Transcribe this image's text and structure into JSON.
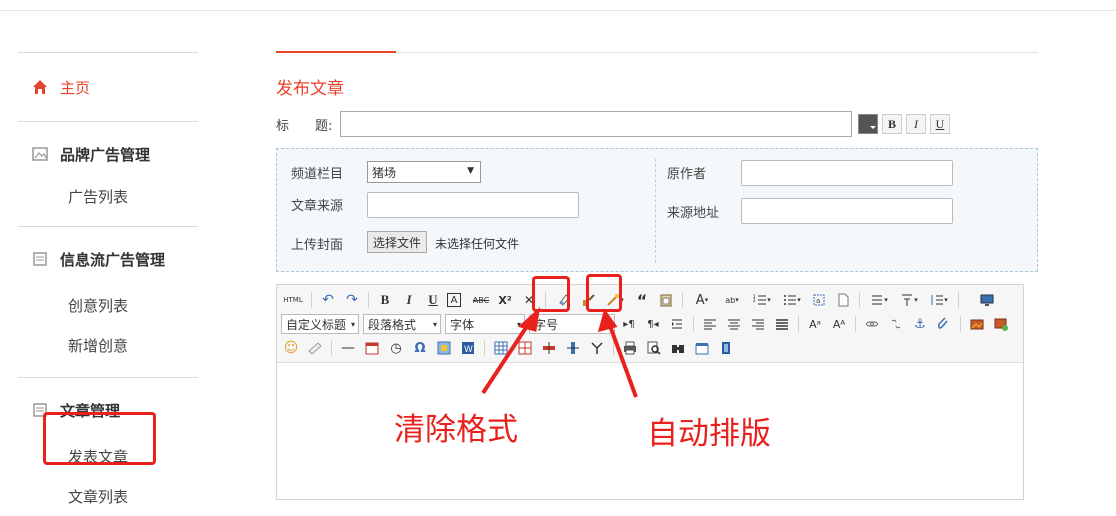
{
  "sidebar": {
    "home": "主页",
    "groups": [
      {
        "title": "品牌广告管理",
        "items": [
          "广告列表"
        ]
      },
      {
        "title": "信息流广告管理",
        "items": [
          "创意列表",
          "新增创意"
        ]
      },
      {
        "title": "文章管理",
        "items": [
          "发表文章",
          "文章列表"
        ]
      }
    ]
  },
  "main": {
    "page_title": "发布文章",
    "title_label": "标　　题:",
    "title_value": "",
    "format_buttons": [
      "B",
      "I",
      "U"
    ],
    "meta": {
      "channel_label": "频道栏目",
      "channel_value": "猪场",
      "source_label": "文章来源",
      "cover_label": "上传封面",
      "file_button": "选择文件",
      "file_status": "未选择任何文件",
      "author_label": "原作者",
      "source_url_label": "来源地址"
    }
  },
  "editor": {
    "row1": [
      "HTML",
      "↶",
      "↷",
      "B",
      "I",
      "U",
      "A",
      "ABC",
      "X²",
      "✕"
    ],
    "combos": [
      "自定义标题",
      "段落格式",
      "字体",
      "字号"
    ]
  },
  "annotations": {
    "clear_format": "清除格式",
    "auto_layout": "自动排版"
  },
  "colors": {
    "accent": "#e8432d",
    "annotation": "#e8211d"
  }
}
